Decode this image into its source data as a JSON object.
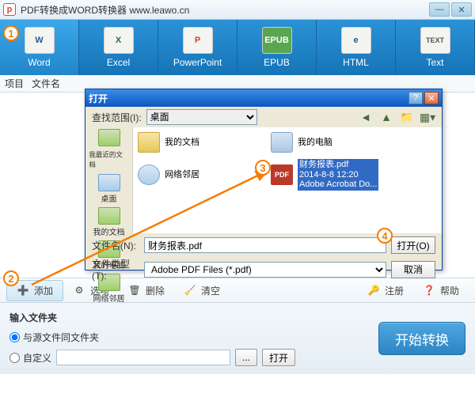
{
  "window": {
    "title": "PDF转换成WORD转换器 www.leawo.cn"
  },
  "tabs": [
    {
      "label": "Word",
      "icon": "W"
    },
    {
      "label": "Excel",
      "icon": "X"
    },
    {
      "label": "PowerPoint",
      "icon": "P"
    },
    {
      "label": "EPUB",
      "icon": "EPUB"
    },
    {
      "label": "HTML",
      "icon": "e"
    },
    {
      "label": "Text",
      "icon": "TEXT"
    }
  ],
  "columns": {
    "c0": "项目",
    "c1": "文件名"
  },
  "actions": {
    "add": "添加",
    "options": "选项",
    "delete": "删除",
    "clear": "清空",
    "register": "注册",
    "help": "帮助"
  },
  "output": {
    "title": "输入文件夹",
    "same_folder": "与源文件同文件夹",
    "custom": "自定义",
    "path": "",
    "browse": "...",
    "open": "打开"
  },
  "start": "开始转换",
  "dialog": {
    "title": "打开",
    "look_in_label": "查找范围(I):",
    "look_in_value": "桌面",
    "places": {
      "recent": "我最近的文档",
      "desktop": "桌面",
      "mydocs": "我的文档",
      "mycomp": "我的电脑",
      "network": "网络邻居"
    },
    "files": {
      "mydocs": "我的文档",
      "mycomp": "我的电脑",
      "network": "网络邻居",
      "selected_name": "财务报表.pdf",
      "selected_line2": "2014-8-8 12:20",
      "selected_line3": "Adobe Acrobat Do..."
    },
    "filename_label": "文件名(N):",
    "filename_value": "财务报表.pdf",
    "filetype_label": "文件类型(T):",
    "filetype_value": "Adobe PDF Files (*.pdf)",
    "open_btn": "打开(O)",
    "cancel_btn": "取消"
  },
  "annotations": {
    "a1": "1",
    "a2": "2",
    "a3": "3",
    "a4": "4"
  }
}
